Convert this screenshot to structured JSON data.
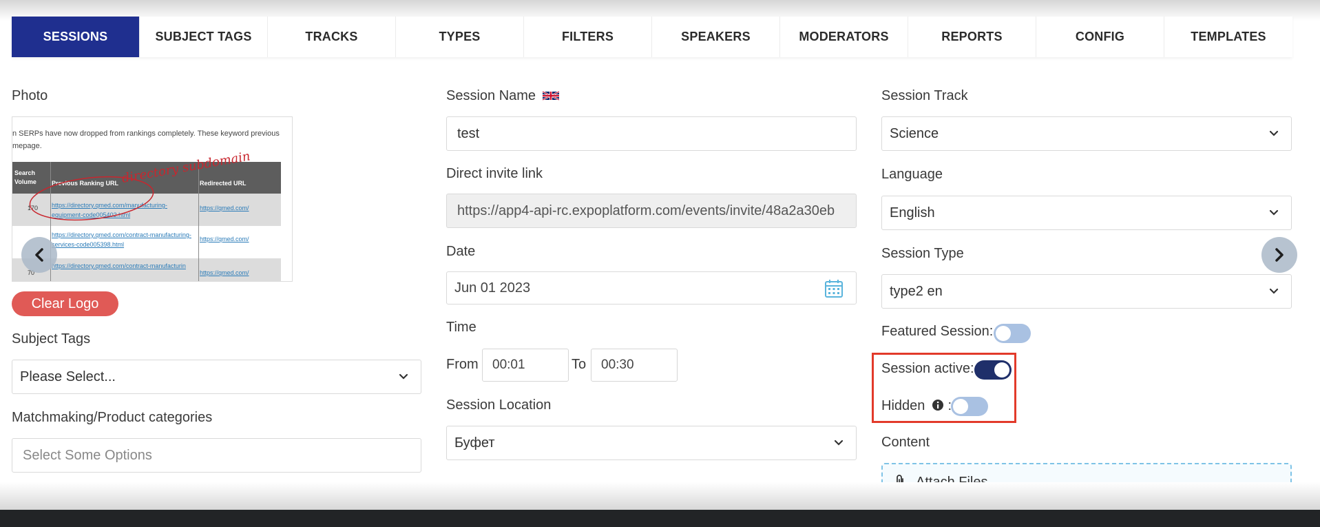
{
  "tabs": [
    {
      "label": "SESSIONS",
      "active": true
    },
    {
      "label": "SUBJECT TAGS",
      "active": false
    },
    {
      "label": "TRACKS",
      "active": false
    },
    {
      "label": "TYPES",
      "active": false
    },
    {
      "label": "FILTERS",
      "active": false
    },
    {
      "label": "SPEAKERS",
      "active": false
    },
    {
      "label": "MODERATORS",
      "active": false
    },
    {
      "label": "REPORTS",
      "active": false
    },
    {
      "label": "CONFIG",
      "active": false
    },
    {
      "label": "TEMPLATES",
      "active": false
    }
  ],
  "left": {
    "photo_label": "Photo",
    "photo_preview": {
      "line1": "n SERPs have now dropped from rankings completely. These keyword previous",
      "line2": "mepage.",
      "header_col1": "Search Volume",
      "header_col2": "Previous Ranking URL",
      "header_col3": "Redirected URL",
      "row1_volume": "170",
      "row1_url": "https://directory.qmed.com/manufacturing-equipment-code005402.html",
      "row1_redirect": "https://qmed.com/",
      "row2_url": "https://directory.qmed.com/contract-manufacturing-services-code005398.html",
      "row2_redirect": "https://qmed.com/",
      "row3_volume": "70",
      "row3_url": "https://directory.qmed.com/contract-manufacturin",
      "row3_redirect": "https://qmed.com/",
      "handwriting": "directory subdomain"
    },
    "clear_logo_label": "Clear Logo",
    "subject_tags_label": "Subject Tags",
    "subject_tags_value": "Please Select...",
    "matchmaking_label": "Matchmaking/Product categories",
    "matchmaking_placeholder": "Select Some Options"
  },
  "middle": {
    "session_name_label": "Session Name",
    "session_name_value": "test",
    "invite_label": "Direct invite link",
    "invite_value": "https://app4-api-rc.expoplatform.com/events/invite/48a2a30eb",
    "date_label": "Date",
    "date_value": "Jun 01 2023",
    "time_label": "Time",
    "from_label": "From",
    "from_value": "00:01",
    "to_label": "To",
    "to_value": "00:30",
    "location_label": "Session Location",
    "location_value": "Буфет"
  },
  "right": {
    "track_label": "Session Track",
    "track_value": "Science",
    "language_label": "Language",
    "language_value": "English",
    "type_label": "Session Type",
    "type_value": "type2 en",
    "featured_label": "Featured Session:",
    "featured_on": false,
    "active_label": "Session active:",
    "active_on": true,
    "hidden_label": "Hidden",
    "hidden_colon": ":",
    "hidden_on": false,
    "content_label": "Content",
    "attach_label": "Attach Files"
  },
  "colors": {
    "tab_active_bg": "#1f2f8f",
    "clear_logo_bg": "#e05a56",
    "toggle_on": "#1f2f6a",
    "toggle_off": "#a9c1e2",
    "highlight": "#e23a2a"
  }
}
